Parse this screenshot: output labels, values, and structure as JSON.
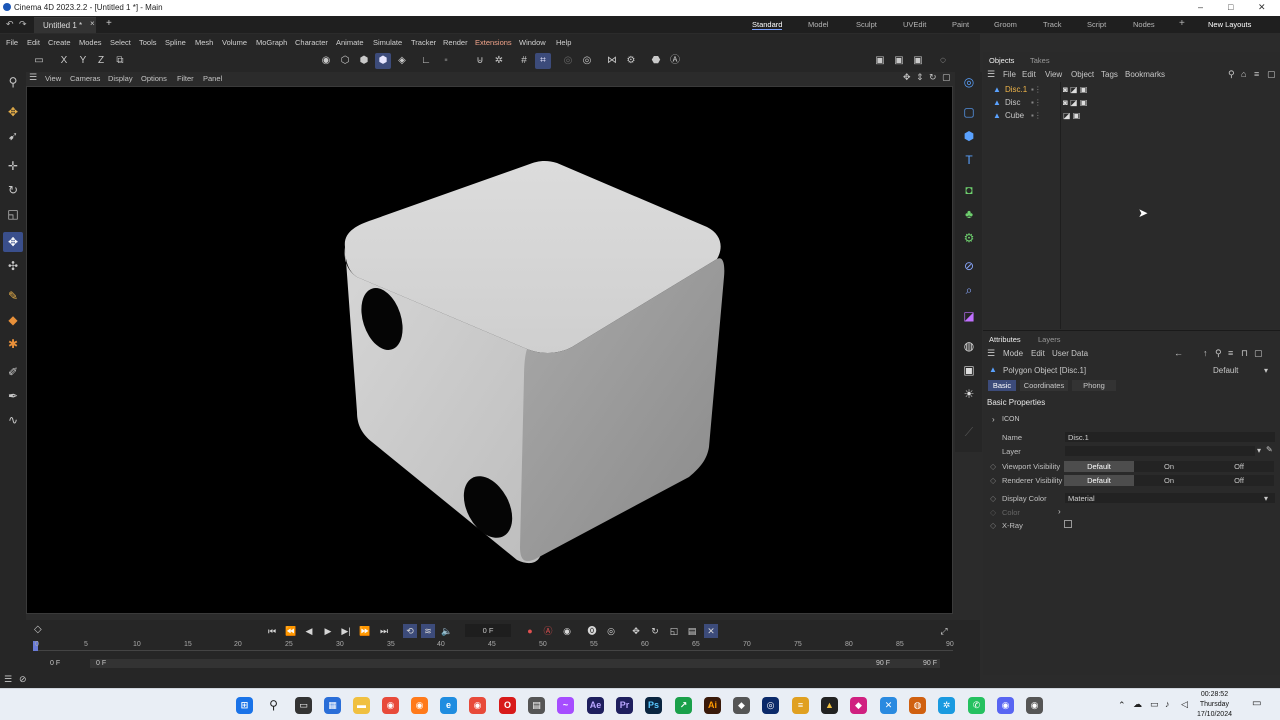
{
  "window": {
    "title": "Cinema 4D 2023.2.2 - [Untitled 1 *] - Main",
    "minimize": "–",
    "maximize": "□",
    "close": "✕"
  },
  "doc_tab": {
    "label": "Untitled 1 *",
    "close": "×",
    "add": "+"
  },
  "layouts": [
    "Standard",
    "Model",
    "Sculpt",
    "UVEdit",
    "Paint",
    "Groom",
    "Track",
    "Script",
    "Nodes"
  ],
  "layouts_add": "+",
  "layouts_new": "New Layouts",
  "menu": [
    "File",
    "Edit",
    "Create",
    "Modes",
    "Select",
    "Tools",
    "Spline",
    "Mesh",
    "Volume",
    "MoGraph",
    "Character",
    "Animate",
    "Simulate",
    "Tracker",
    "Render",
    "Extensions",
    "Window",
    "Help"
  ],
  "toolbar": {
    "axis_x": "X",
    "axis_y": "Y",
    "axis_z": "Z"
  },
  "viewport_menu": [
    "View",
    "Cameras",
    "Display",
    "Options",
    "Filter",
    "Panel"
  ],
  "objects_panel": {
    "tabs": [
      "Objects",
      "Takes"
    ],
    "menu": [
      "File",
      "Edit",
      "View",
      "Object",
      "Tags",
      "Bookmarks"
    ],
    "items": [
      {
        "name": "Disc.1",
        "selected": true
      },
      {
        "name": "Disc",
        "selected": false
      },
      {
        "name": "Cube",
        "selected": false
      }
    ]
  },
  "attributes_panel": {
    "tabs": [
      "Attributes",
      "Layers"
    ],
    "menu": [
      "Mode",
      "Edit",
      "User Data"
    ],
    "object_title": "Polygon Object [Disc.1]",
    "preset": "Default",
    "subtabs": [
      "Basic",
      "Coordinates",
      "Phong"
    ],
    "section": "Basic Properties",
    "icon_label": "ICON",
    "fields": {
      "name_label": "Name",
      "name_value": "Disc.1",
      "layer_label": "Layer",
      "viewport_vis_label": "Viewport Visibility",
      "renderer_vis_label": "Renderer Visibility",
      "vis_options": [
        "Default",
        "On",
        "Off"
      ],
      "display_color_label": "Display Color",
      "display_color_value": "Material",
      "color_label": "Color",
      "xray_label": "X-Ray"
    }
  },
  "timeline": {
    "current_frame": "0 F",
    "ticks": [
      "0",
      "5",
      "10",
      "15",
      "20",
      "25",
      "30",
      "35",
      "40",
      "45",
      "50",
      "55",
      "60",
      "65",
      "70",
      "75",
      "80",
      "85",
      "90"
    ],
    "range_start": "0 F",
    "range_start2": "0 F",
    "range_end": "90 F",
    "range_end2": "90 F"
  },
  "taskbar": {
    "clock_time": "00:28:52",
    "clock_day": "Thursday",
    "clock_date": "17/10/2024"
  },
  "colors": {
    "accent": "#3c4b7a",
    "viewport_bg": "#000000",
    "cube": "#cfcfcf"
  }
}
